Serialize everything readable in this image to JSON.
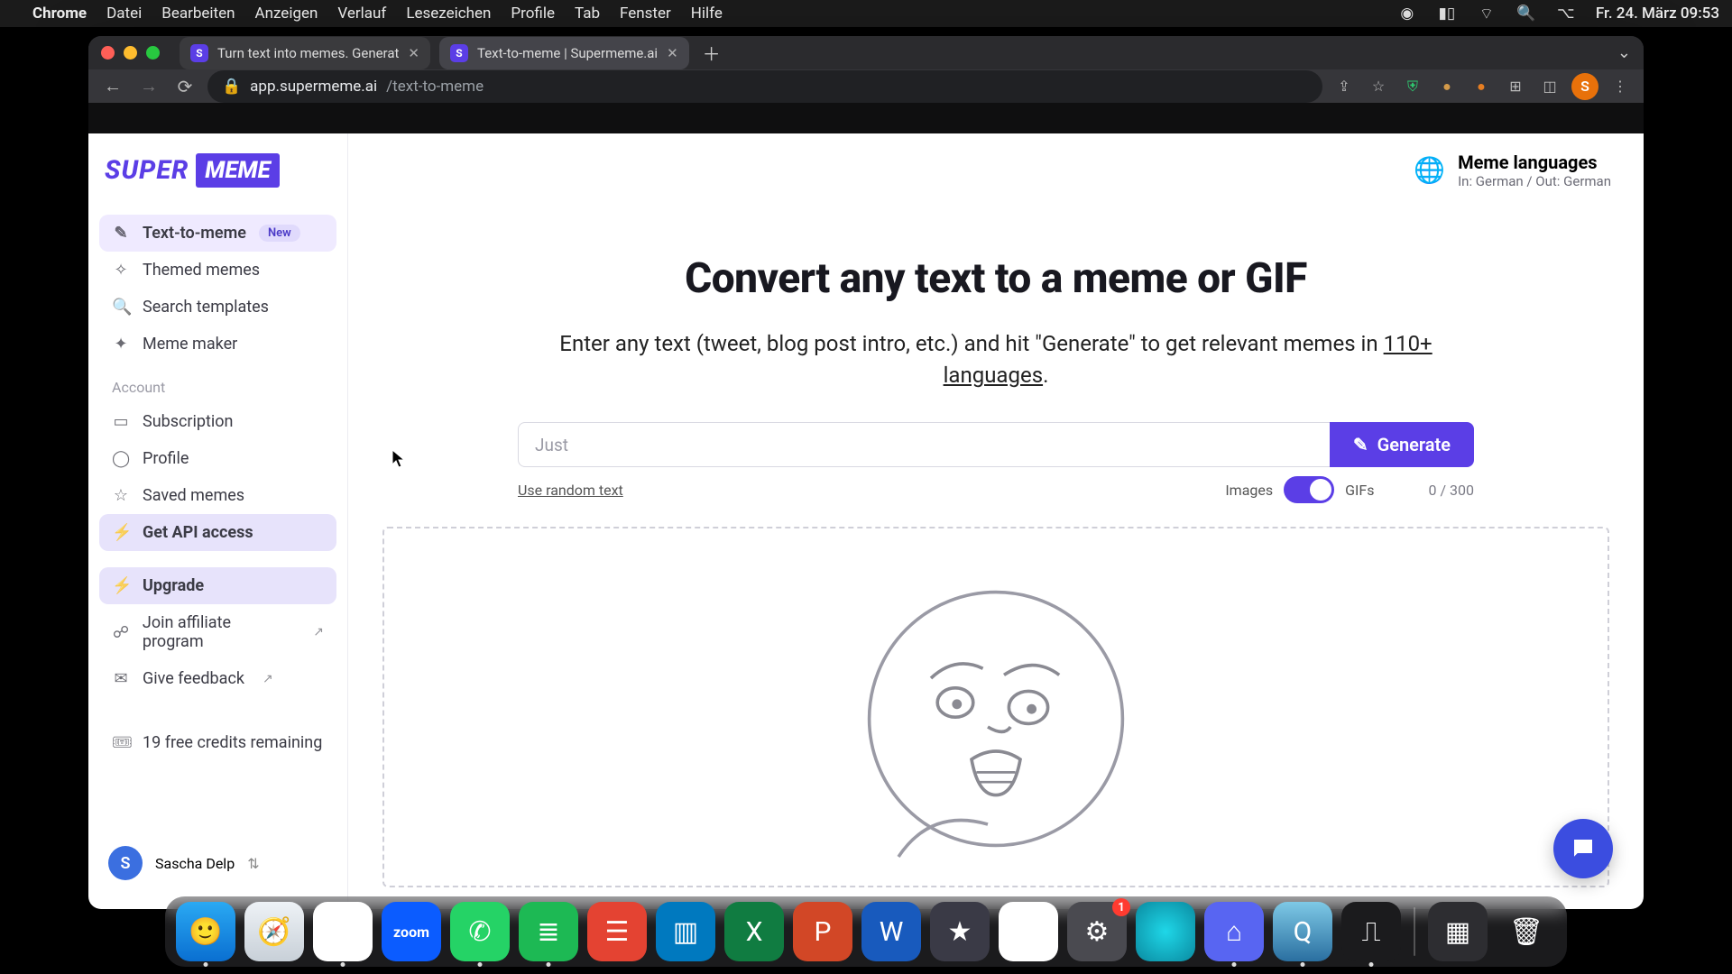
{
  "menubar": {
    "appname": "Chrome",
    "items": [
      "Datei",
      "Bearbeiten",
      "Anzeigen",
      "Verlauf",
      "Lesezeichen",
      "Profile",
      "Tab",
      "Fenster",
      "Hilfe"
    ],
    "clock": "Fr. 24. März  09:53"
  },
  "browser": {
    "tabs": [
      {
        "favicon": "S",
        "title": "Turn text into memes. Generat"
      },
      {
        "favicon": "S",
        "title": "Text-to-meme | Supermeme.ai"
      }
    ],
    "url_host": "app.supermeme.ai",
    "url_path": "/text-to-meme",
    "avatar_initial": "S"
  },
  "logo": {
    "part1": "SUPER",
    "part2": "MEME"
  },
  "sidebar": {
    "items": [
      {
        "icon": "✎",
        "label": "Text-to-meme",
        "badge": "New",
        "active": true
      },
      {
        "icon": "✧",
        "label": "Themed memes"
      },
      {
        "icon": "🔍",
        "label": "Search templates"
      },
      {
        "icon": "✦",
        "label": "Meme maker"
      }
    ],
    "account_label": "Account",
    "account_items": [
      {
        "icon": "▭",
        "label": "Subscription"
      },
      {
        "icon": "◯",
        "label": "Profile"
      },
      {
        "icon": "☆",
        "label": "Saved memes"
      },
      {
        "icon": "⚡",
        "label": "Get API access",
        "highlight": true
      }
    ],
    "upgrade": {
      "icon": "⚡",
      "label": "Upgrade"
    },
    "extra": [
      {
        "label": "Join affiliate program",
        "ext": true
      },
      {
        "label": "Give feedback",
        "ext": true
      }
    ],
    "credits": {
      "icon": "🎟",
      "label": "19 free credits remaining"
    },
    "user": {
      "initial": "S",
      "name": "Sascha Delp"
    }
  },
  "lang": {
    "title": "Meme languages",
    "sub": "In: German / Out: German"
  },
  "hero": {
    "title": "Convert any text to a meme or GIF",
    "lead": "Enter any text (tweet, blog post intro, etc.) and hit \"Generate\" to get relevant memes in ",
    "link": "110+ languages",
    "tail": "."
  },
  "input": {
    "placeholder": "Just",
    "value": "",
    "generate": "Generate",
    "random": "Use random text",
    "left": "Images",
    "right": "GIFs",
    "count": "0 / 300"
  },
  "dock": {
    "apps": [
      {
        "name": "finder",
        "bg": "linear-gradient(180deg,#2aa9f3,#0a6fd1)",
        "glyph": "🙂",
        "running": true
      },
      {
        "name": "safari",
        "bg": "linear-gradient(180deg,#eef2f6,#c8d0d8)",
        "glyph": "🧭",
        "running": false
      },
      {
        "name": "chrome",
        "bg": "#fff",
        "glyph": "◉",
        "running": true
      },
      {
        "name": "zoom",
        "bg": "#0b5cff",
        "glyph": "zoom",
        "running": false,
        "text": true
      },
      {
        "name": "whatsapp",
        "bg": "#25d366",
        "glyph": "✆",
        "running": true
      },
      {
        "name": "spotify",
        "bg": "#1db954",
        "glyph": "≣",
        "running": true
      },
      {
        "name": "todoist",
        "bg": "#e44332",
        "glyph": "☰",
        "running": false
      },
      {
        "name": "trello",
        "bg": "#0079bf",
        "glyph": "▥",
        "running": false
      },
      {
        "name": "excel",
        "bg": "#107c41",
        "glyph": "X",
        "running": false
      },
      {
        "name": "powerpoint",
        "bg": "#d24726",
        "glyph": "P",
        "running": false
      },
      {
        "name": "word",
        "bg": "#185abd",
        "glyph": "W",
        "running": false
      },
      {
        "name": "imovie",
        "bg": "#3a3a46",
        "glyph": "★",
        "running": false
      },
      {
        "name": "drive",
        "bg": "#fff",
        "glyph": "▲",
        "running": false
      },
      {
        "name": "settings",
        "bg": "#4a4a50",
        "glyph": "⚙",
        "running": false,
        "badge": "1"
      },
      {
        "name": "siri",
        "bg": "radial-gradient(circle,#1fd7e8,#0a8aa0)",
        "glyph": "",
        "running": false
      },
      {
        "name": "discord",
        "bg": "#5865f2",
        "glyph": "⌂",
        "running": true
      },
      {
        "name": "quicktime",
        "bg": "linear-gradient(180deg,#7ec9e6,#2a6fa0)",
        "glyph": "Q",
        "running": true
      },
      {
        "name": "voice",
        "bg": "#1b1b1d",
        "glyph": "⎍",
        "running": true
      }
    ],
    "right": [
      {
        "name": "mission",
        "bg": "#2d2d31",
        "glyph": "▦"
      },
      {
        "name": "trash",
        "bg": "transparent",
        "glyph": "🗑"
      }
    ]
  }
}
